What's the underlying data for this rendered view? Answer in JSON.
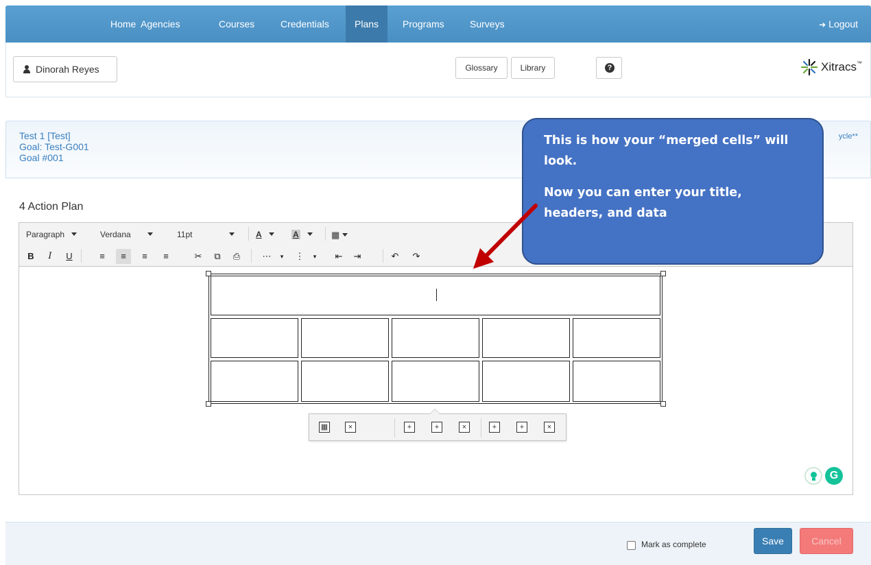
{
  "nav": {
    "items": [
      "Home",
      "Agencies",
      "Courses",
      "Credentials",
      "Plans",
      "Programs",
      "Surveys"
    ],
    "active": "Plans",
    "logout": "Logout"
  },
  "header": {
    "user_name": "Dinorah Reyes",
    "glossary": "Glossary",
    "library": "Library",
    "logo_text": "Xitracs",
    "logo_tm": "™"
  },
  "goal": {
    "line1": "Test 1 [Test]",
    "line2": "Goal: Test-G001",
    "line3": "Goal #001",
    "right_text": "ycle**"
  },
  "section": {
    "title": "4 Action Plan"
  },
  "toolbar": {
    "block_format": "Paragraph",
    "font_family": "Verdana",
    "font_size": "11pt",
    "text_color": "A",
    "bg_color": "A"
  },
  "callout": {
    "line1": "This is how your “merged cells” will look.",
    "line2": "Now you can enter your title, headers, and data"
  },
  "footer": {
    "mark_complete": "Mark as complete",
    "save": "Save",
    "cancel": "Cancel"
  },
  "colors": {
    "nav_bg": "#4a8fc3",
    "nav_active": "#3b7aaa",
    "callout_bg": "#4472c4",
    "arrow": "#c00000",
    "save_bg": "#3a7fb4",
    "cancel_bg": "#f47a7a",
    "link": "#3a7fbf"
  }
}
